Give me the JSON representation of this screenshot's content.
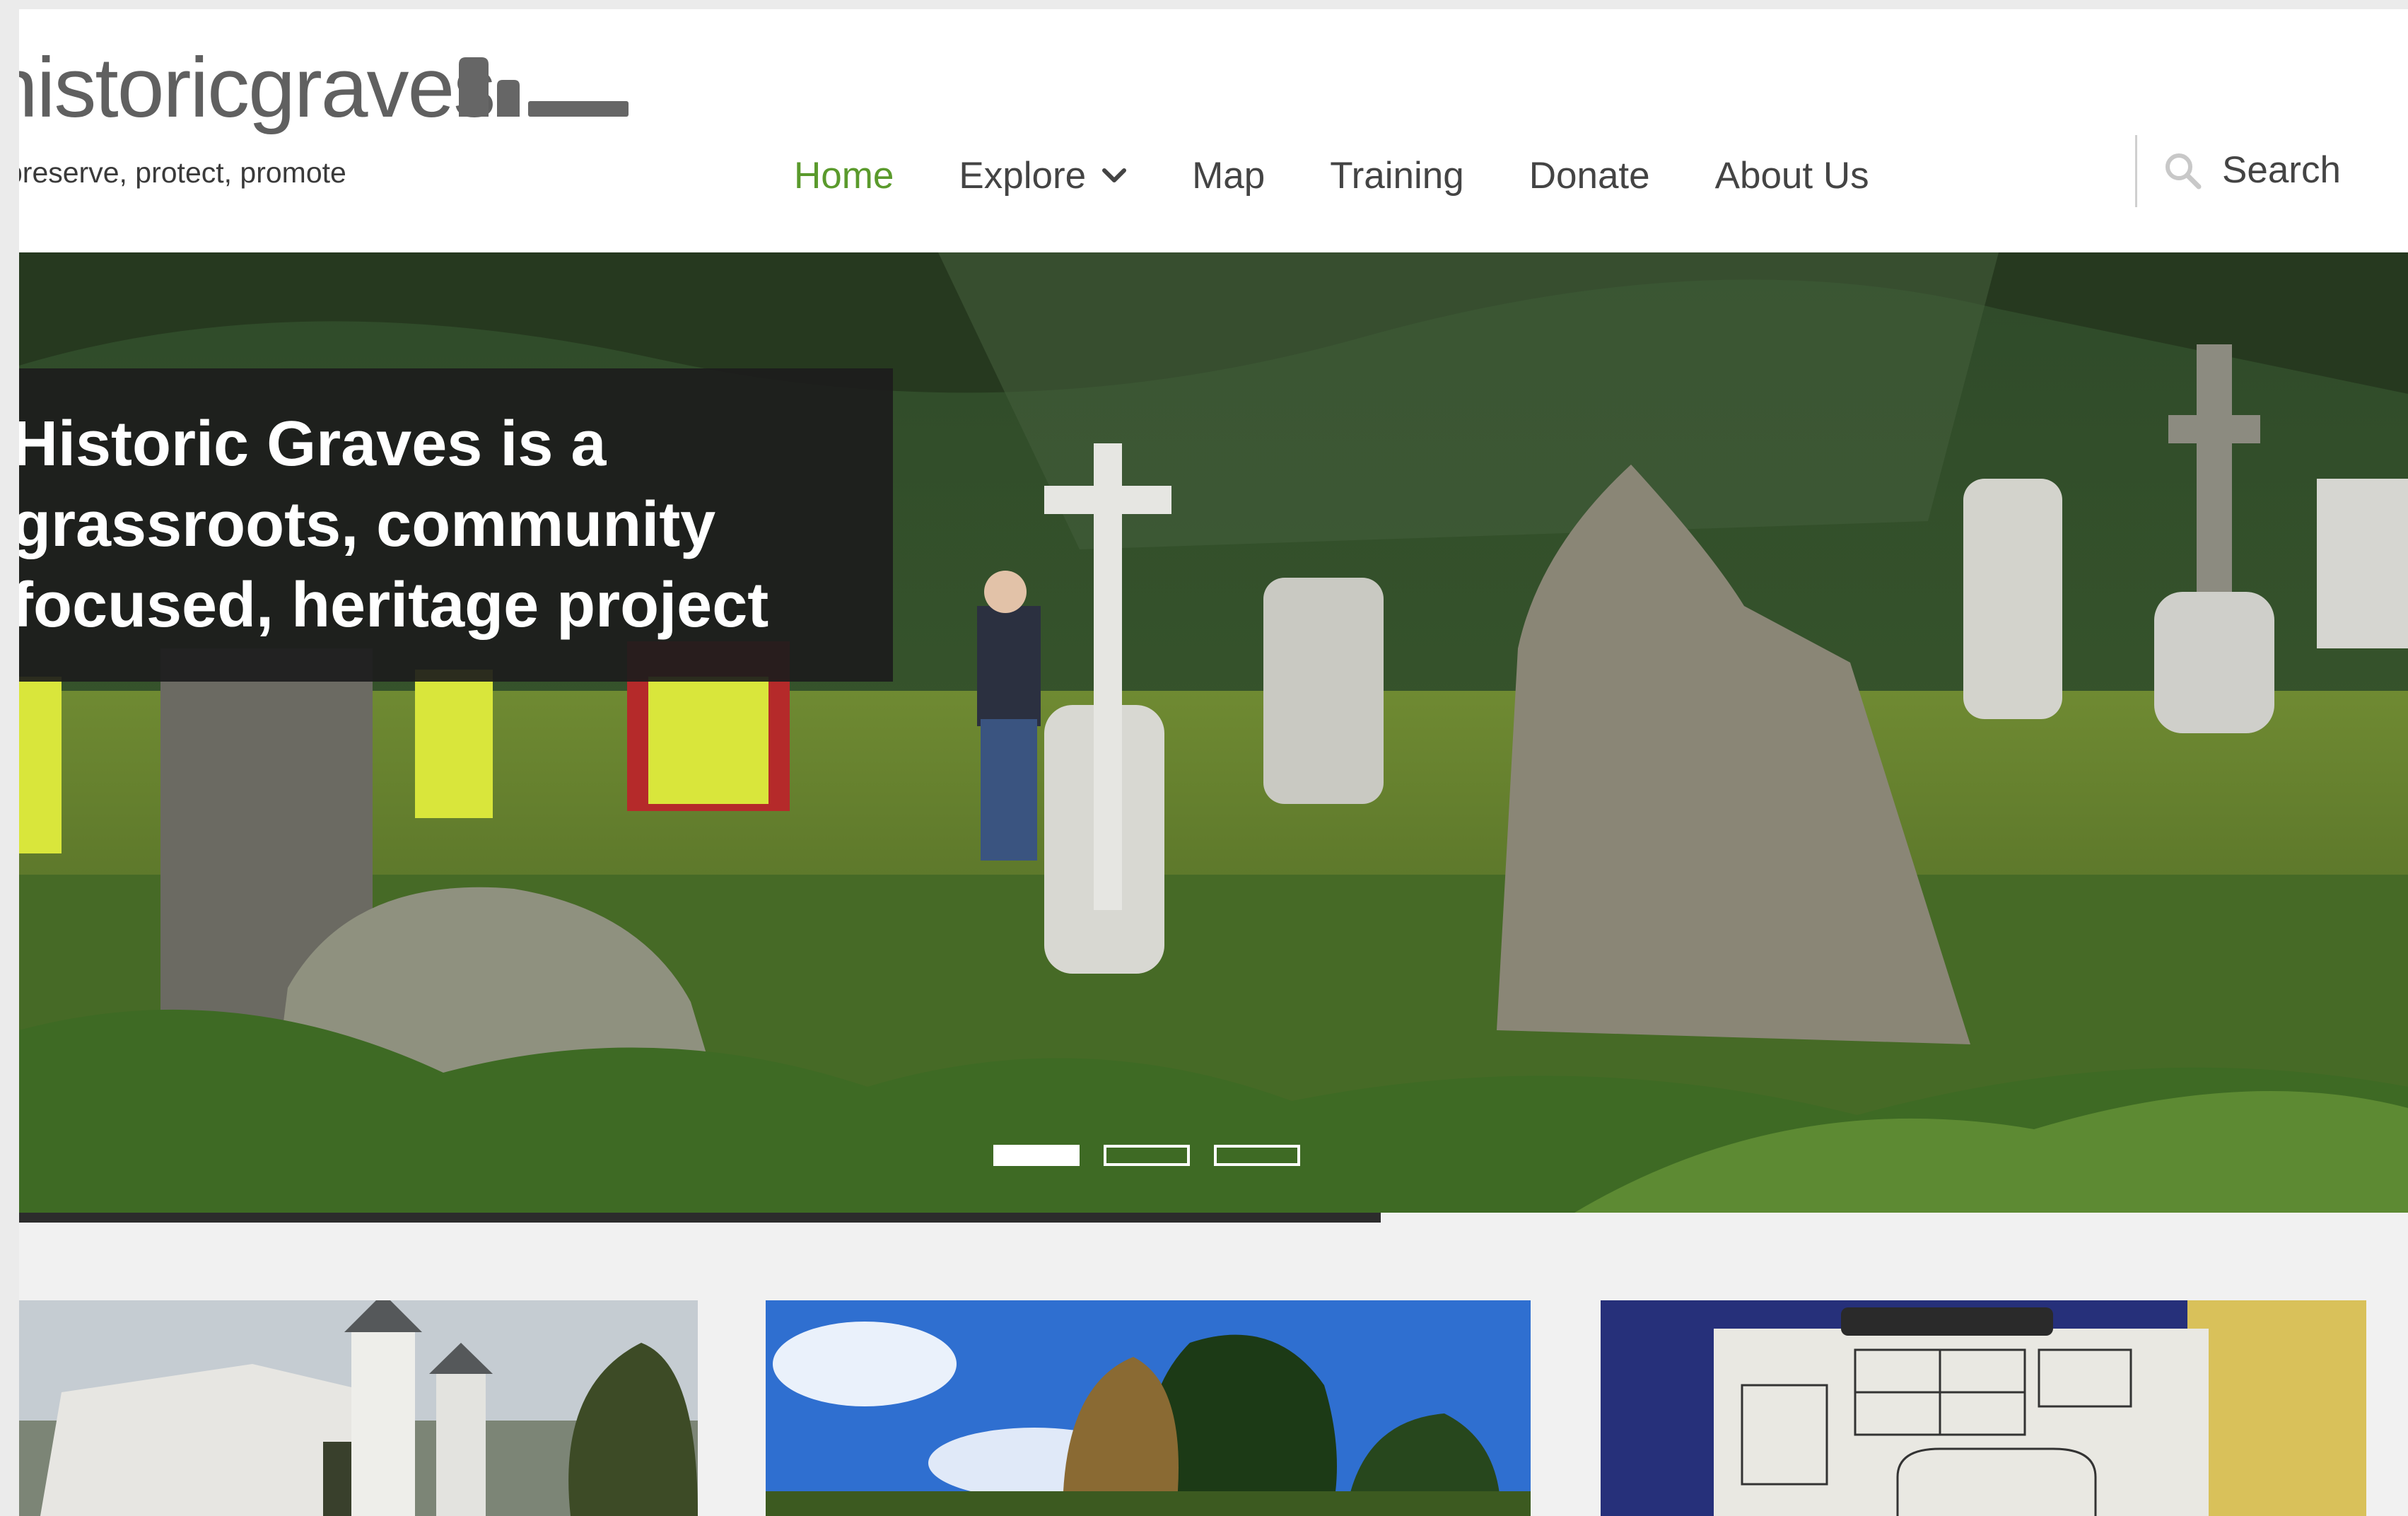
{
  "header": {
    "logo_text": "historicgraves",
    "tagline": "preserve, protect, promote"
  },
  "nav": {
    "items": [
      {
        "label": "Home",
        "active": true
      },
      {
        "label": "Explore",
        "has_dropdown": true
      },
      {
        "label": "Map"
      },
      {
        "label": "Training"
      },
      {
        "label": "Donate"
      },
      {
        "label": "About Us"
      }
    ],
    "search_label": "Search"
  },
  "hero": {
    "caption": "Historic Graves is a\ngrassroots, community\nfocused, heritage project",
    "slides_total": 3,
    "active_slide": 1,
    "progress_fraction": 0.57
  },
  "colors": {
    "accent_green": "#5a9a2c",
    "nav_text": "#444444",
    "caption_bg": "#1c1c1c"
  },
  "cards": [
    {
      "image": "church-in-fog-photo"
    },
    {
      "image": "graveyard-trees-blue-sky-photo"
    },
    {
      "image": "hand-drawn-graveyard-map-photo"
    }
  ]
}
